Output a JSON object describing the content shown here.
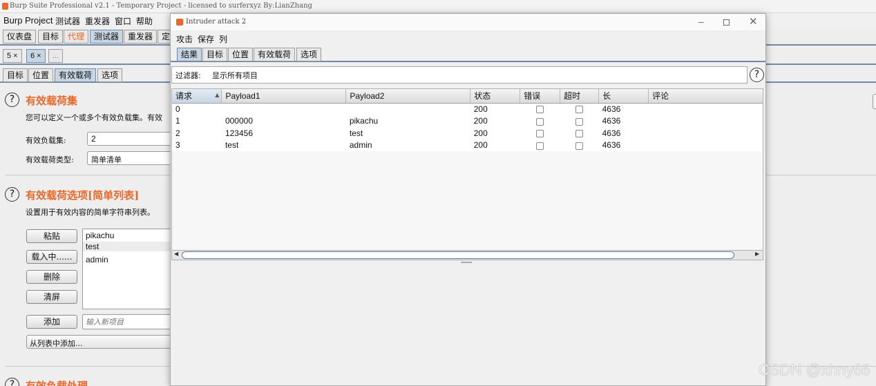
{
  "app_title": "Burp Suite Professional v2.1 - Temporary Project - licensed to surferxyz By:LianZhang",
  "menu": [
    "Burp",
    "Project",
    "测试器",
    "重发器",
    "窗口",
    "帮助"
  ],
  "main_tabs": [
    {
      "label": "仪表盘",
      "selected": false
    },
    {
      "label": "目标",
      "selected": false
    },
    {
      "label": "代理",
      "selected": false,
      "color": "#e8692b"
    },
    {
      "label": "测试器",
      "selected": true
    },
    {
      "label": "重发器",
      "selected": false
    },
    {
      "label": "定",
      "selected": false
    }
  ],
  "attack_tabs": [
    "5 ×",
    "6 ×",
    "..."
  ],
  "sub_tabs": [
    {
      "label": "目标",
      "selected": false
    },
    {
      "label": "位置",
      "selected": false
    },
    {
      "label": "有效载荷",
      "selected": true
    },
    {
      "label": "选项",
      "selected": false
    }
  ],
  "payload_sets": {
    "title": "有效载荷集",
    "desc": "您可以定义一个或多个有效负载集。有效",
    "set_label": "有效负载集:",
    "set_value": "2",
    "type_label": "有效载荷类型:",
    "type_value": "简单清单"
  },
  "payload_options": {
    "title": "有效载荷选项",
    "title_suffix": "[简单列表]",
    "desc": "设置用于有效内容的简单字符串列表。",
    "buttons": {
      "paste": "粘贴",
      "load": "载入中......",
      "remove": "删除",
      "clear": "清屏",
      "add": "添加",
      "add_from_list": "从列表中添加..."
    },
    "items": [
      "pikachu",
      "test",
      "admin"
    ],
    "add_placeholder": "输入新项目"
  },
  "payload_processing_title": "有效负载处理",
  "attack_window": {
    "title": "Intruder attack 2",
    "menu": [
      "攻击",
      "保存",
      "列"
    ],
    "tabs": [
      {
        "label": "结果",
        "selected": true
      },
      {
        "label": "目标",
        "selected": false
      },
      {
        "label": "位置",
        "selected": false
      },
      {
        "label": "有效载荷",
        "selected": false
      },
      {
        "label": "选项",
        "selected": false
      }
    ],
    "filter_label": "过滤器:",
    "filter_text": "显示所有项目",
    "columns": [
      "请求",
      "Payload1",
      "Payload2",
      "状态",
      "错误",
      "超时",
      "长",
      "评论"
    ],
    "sort_indicator": "▲",
    "rows": [
      {
        "request": "0",
        "payload1": "",
        "payload2": "",
        "status": "200",
        "error": false,
        "timeout": false,
        "length": "4636",
        "comment": ""
      },
      {
        "request": "1",
        "payload1": "000000",
        "payload2": "pikachu",
        "status": "200",
        "error": false,
        "timeout": false,
        "length": "4636",
        "comment": ""
      },
      {
        "request": "2",
        "payload1": "123456",
        "payload2": "test",
        "status": "200",
        "error": false,
        "timeout": false,
        "length": "4636",
        "comment": ""
      },
      {
        "request": "3",
        "payload1": "test",
        "payload2": "admin",
        "status": "200",
        "error": false,
        "timeout": false,
        "length": "4636",
        "comment": ""
      }
    ]
  },
  "watermark": "CSDN @xhny66",
  "colors": {
    "accent": "#e8692b",
    "selected_tab": "#c8d5e3",
    "burp_logo": "#e8692b"
  }
}
